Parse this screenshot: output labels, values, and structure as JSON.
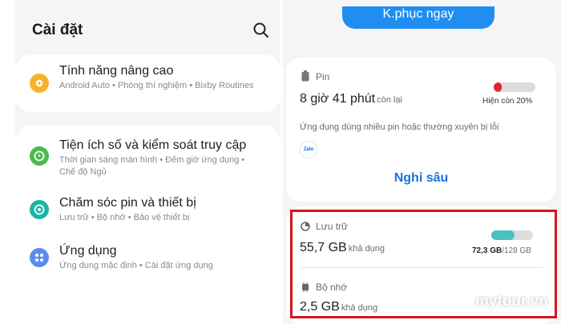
{
  "left": {
    "title": "Cài đặt",
    "items": [
      {
        "title": "Tính năng nâng cao",
        "subtitle": "Android Auto • Phòng thí nghiệm • Bixby Routines",
        "icon": "gear-plus-icon",
        "color": "#f6b32a"
      },
      {
        "title": "Tiện ích số và kiểm soát truy cập",
        "subtitle": "Thời gian sáng màn hình • Đếm giờ ứng dụng • Chế độ Ngủ",
        "icon": "digital-wellbeing-icon",
        "color": "#4cb84f"
      },
      {
        "title": "Chăm sóc pin và thiết bị",
        "subtitle": "Lưu trữ • Bộ nhớ • Bảo vệ thiết bị",
        "icon": "device-care-icon",
        "color": "#1bb5a6"
      },
      {
        "title": "Ứng dụng",
        "subtitle": "Ứng dụng mặc định • Cài đặt ứng dụng",
        "icon": "apps-grid-icon",
        "color": "#5b8cf0"
      }
    ]
  },
  "right": {
    "restore_button": "K.phục ngay",
    "battery": {
      "label": "Pin",
      "time": "8 giờ 41 phút",
      "time_suffix": "còn lại",
      "remaining": "Hiện còn 20%",
      "level": 0.2,
      "level_color": "#e2262b",
      "usage_text": "Ứng dụng dùng nhiều pin hoặc thường xuyên bị lỗi",
      "app_name": "Zalo",
      "deep_sleep_link": "Nghỉ sâu"
    },
    "storage": {
      "label": "Lưu trữ",
      "value": "55,7 GB",
      "suffix": "khả dụng",
      "used": "72,3 GB",
      "total": "/128 GB",
      "level": 0.565,
      "level_color": "#4bc0c0"
    },
    "memory": {
      "label": "Bộ nhớ",
      "value": "2,5 GB",
      "suffix": "khả dụng"
    }
  },
  "watermark": "mytour.vn"
}
